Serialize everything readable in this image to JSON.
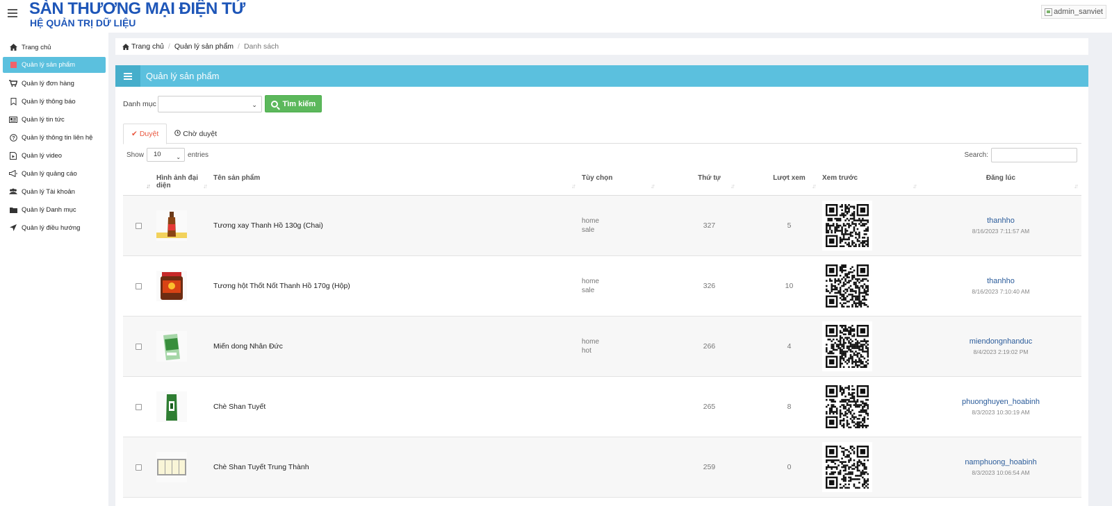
{
  "header": {
    "title": "SÀN THƯƠNG MẠI ĐIỆN TỬ",
    "subtitle": "HỆ QUẢN TRỊ DỮ LIỆU",
    "user": "admin_sanviet"
  },
  "sidebar": {
    "items": [
      {
        "label": "Trang chủ",
        "icon": "home-icon"
      },
      {
        "label": "Quản lý sản phẩm",
        "icon": "product-icon",
        "active": true
      },
      {
        "label": "Quản lý đơn hàng",
        "icon": "cart-icon"
      },
      {
        "label": "Quản lý thông báo",
        "icon": "bookmark-icon"
      },
      {
        "label": "Quản lý tin tức",
        "icon": "newspaper-icon"
      },
      {
        "label": "Quản lý thông tin liên hệ",
        "icon": "question-icon"
      },
      {
        "label": "Quản lý video",
        "icon": "video-icon"
      },
      {
        "label": "Quản lý quảng cáo",
        "icon": "megaphone-icon"
      },
      {
        "label": "Quản lý Tài khoản",
        "icon": "users-icon"
      },
      {
        "label": "Quản lý Danh mục",
        "icon": "folder-icon"
      },
      {
        "label": "Quản lý điều hướng",
        "icon": "location-arrow-icon"
      }
    ]
  },
  "breadcrumb": {
    "home": "Trang chủ",
    "section": "Quản lý sản phẩm",
    "current": "Danh sách"
  },
  "panel": {
    "title": "Quản lý sản phẩm",
    "filter_label": "Danh mục",
    "filter_value": "",
    "search_button": "Tìm kiếm",
    "tabs": [
      "Duyệt",
      "Chờ duyệt"
    ],
    "show_label": "Show",
    "entries_label": "entries",
    "page_length": "10",
    "search_label": "Search:"
  },
  "table": {
    "headers": {
      "image": "Hình ảnh đại diện",
      "name": "Tên sản phẩm",
      "options": "Tùy chọn",
      "order": "Thứ tự",
      "views": "Lượt xem",
      "preview": "Xem trước",
      "posted": "Đăng lúc"
    },
    "rows": [
      {
        "name": "Tương xay Thanh Hồ 130g (Chai)",
        "opt1": "home",
        "opt2": "sale",
        "order": "327",
        "views": "5",
        "user": "thanhho",
        "date": "8/16/2023 7:11:57 AM",
        "thumb": "bottle"
      },
      {
        "name": "Tương hột Thốt Nốt Thanh Hồ 170g (Hộp)",
        "opt1": "home",
        "opt2": "sale",
        "order": "326",
        "views": "10",
        "user": "thanhho",
        "date": "8/16/2023 7:10:40 AM",
        "thumb": "jar"
      },
      {
        "name": "Miến dong Nhân Đức",
        "opt1": "home",
        "opt2": "hot",
        "order": "266",
        "views": "4",
        "user": "miendongnhanduc",
        "date": "8/4/2023 2:19:02 PM",
        "thumb": "box"
      },
      {
        "name": "Chè Shan Tuyết",
        "opt1": "",
        "opt2": "",
        "order": "265",
        "views": "8",
        "user": "phuonghuyen_hoabinh",
        "date": "8/3/2023 10:30:19 AM",
        "thumb": "bag"
      },
      {
        "name": "Chè Shan Tuyết Trung Thành",
        "opt1": "",
        "opt2": "",
        "order": "259",
        "views": "0",
        "user": "namphuong_hoabinh",
        "date": "8/3/2023 10:06:54 AM",
        "thumb": "packs"
      }
    ]
  }
}
